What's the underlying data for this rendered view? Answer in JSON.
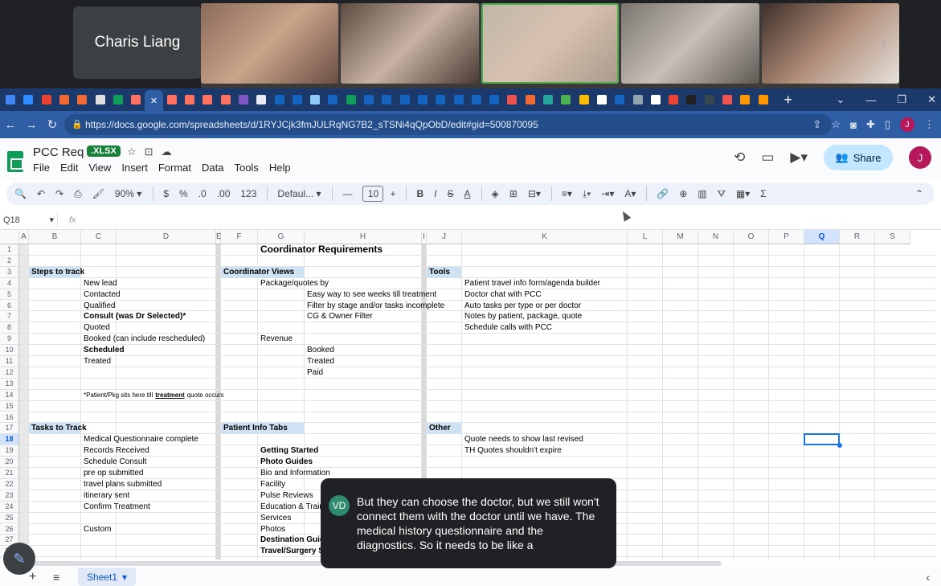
{
  "meeting": {
    "participant_name": "Charis Liang",
    "caption_speaker_initials": "VD",
    "caption_text": "But they can choose the doctor, but we still won't connect them with the doctor until we have. The medical history questionnaire and the diagnostics. So it needs to be like a"
  },
  "browser": {
    "url": "https://docs.google.com/spreadsheets/d/1RYJCjk3fmJULRqNG7B2_sTSNi4qQpObD/edit#gid=500870095",
    "profile_initial": "J"
  },
  "doc": {
    "title": "PCC Req",
    "badge": ".XLSX",
    "menus": [
      "File",
      "Edit",
      "View",
      "Insert",
      "Format",
      "Data",
      "Tools",
      "Help"
    ],
    "share_label": "Share",
    "user_initial": "J"
  },
  "toolbar": {
    "zoom": "90%",
    "currency": "$",
    "percent": "%",
    "dec_decrease": ".0",
    "dec_increase": ".00",
    "number_format": "123",
    "font": "Defaul...",
    "font_size": "10"
  },
  "formula": {
    "namebox": "Q18",
    "fx": "fx"
  },
  "grid": {
    "columns": [
      "A",
      "B",
      "C",
      "D",
      "E",
      "F",
      "G",
      "H",
      "I",
      "J",
      "K",
      "L",
      "M",
      "N",
      "O",
      "P",
      "Q",
      "R",
      "S"
    ],
    "rows": [
      "1",
      "2",
      "3",
      "4",
      "5",
      "6",
      "7",
      "8",
      "9",
      "10",
      "11",
      "12",
      "13",
      "14",
      "15",
      "16",
      "17",
      "18",
      "19",
      "20",
      "21",
      "22",
      "23",
      "24",
      "25",
      "26",
      "27",
      "28"
    ],
    "title": "Coordinator Requirements",
    "steps_header": "Steps to track",
    "steps": [
      "New lead",
      "Contacted",
      "Qualified",
      "Consult (was Dr Selected)*",
      "Quoted",
      "Booked (can include rescheduled)",
      "Scheduled",
      "Treated"
    ],
    "note": "*Patient/Pkg sits here till",
    "note_bold": "treatment",
    "note_tail": "quote occurs",
    "coord_header": "Coordinator Views",
    "package_label": "Package/quotes by",
    "package_items": [
      "Easy way to see weeks till  treatment",
      "Filter by stage and/or tasks incomplete",
      "CG & Owner Filter"
    ],
    "revenue_label": "Revenue",
    "revenue_items": [
      "Booked",
      "Treated",
      "Paid"
    ],
    "tools_header": "Tools",
    "tools_items": [
      "Patient travel info form/agenda builder",
      "Doctor chat with PCC",
      "Auto tasks per type or per doctor",
      "Notes by patient, package, quote",
      "Schedule calls with PCC"
    ],
    "tasks_header": "Tasks to Track",
    "tasks": [
      "Medical Questionnaire complete",
      "Records Received",
      "Schedule Consult",
      "pre op submitted",
      "travel plans submitted",
      "itinerary sent",
      "Confirm Treatment",
      "",
      "Custom"
    ],
    "patient_header": "Patient Info Tabs",
    "patient_tabs": [
      "Getting Started",
      "Photo Guides",
      "Bio and Information",
      "Facility",
      "Pulse Reviews",
      "Education & Trair",
      "Services",
      "Photos",
      "Destination Guid",
      "Travel/Surgery Sc"
    ],
    "other_header": "Other",
    "other_items": [
      "Quote needs to show last revised",
      "TH Quotes shouldn't expire"
    ]
  },
  "sheets": {
    "active_sheet": "Sheet1"
  }
}
